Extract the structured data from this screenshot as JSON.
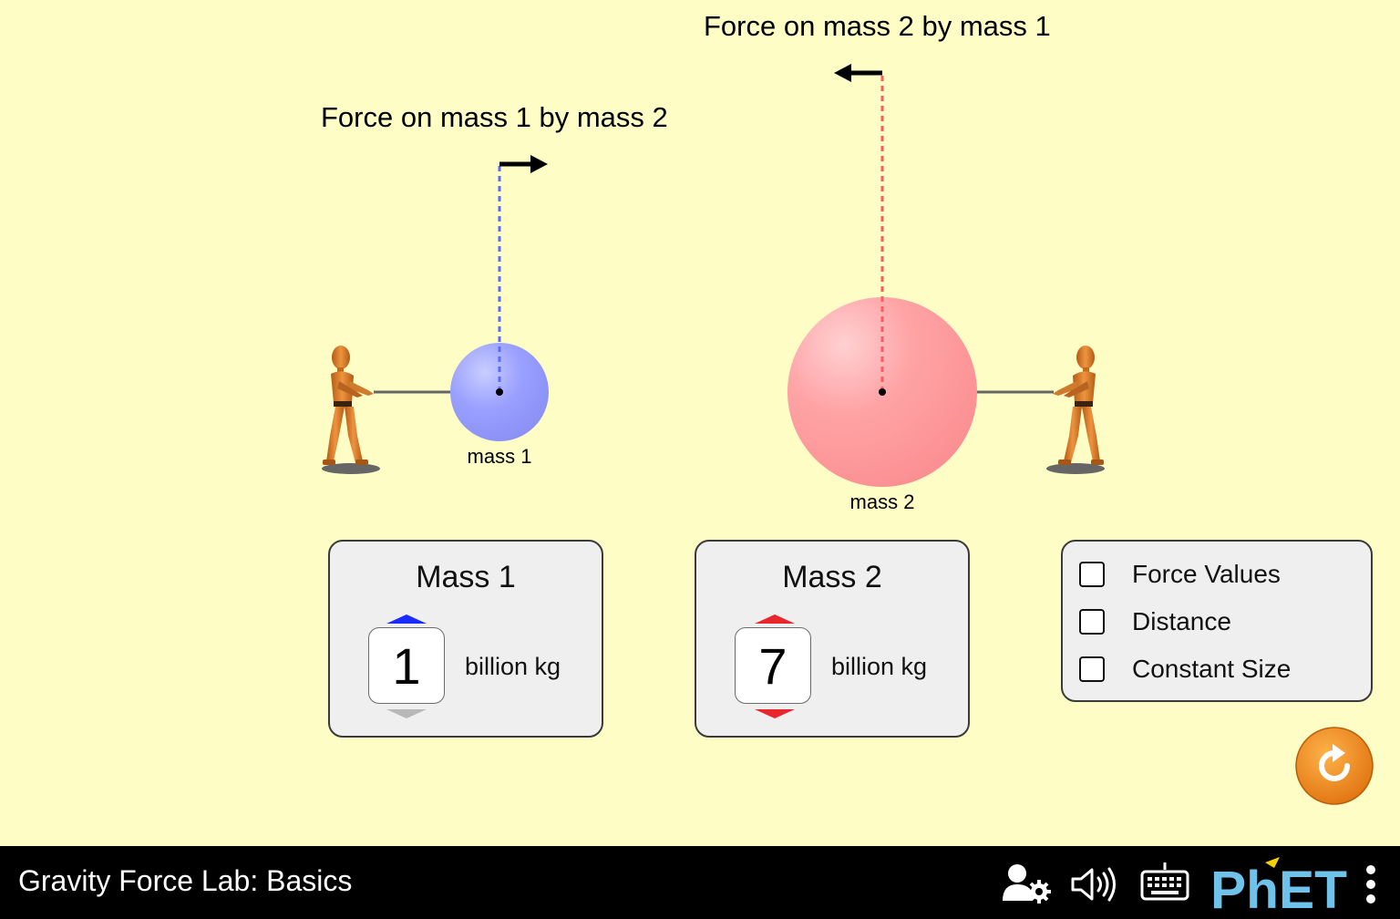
{
  "app": {
    "title": "Gravity Force Lab: Basics",
    "brand": "PhET"
  },
  "forces": {
    "on_mass1": "Force on mass 1 by mass 2",
    "on_mass2": "Force on mass 2 by mass 1"
  },
  "masses": {
    "mass1": {
      "label": "mass 1",
      "color": "#9aa0ff"
    },
    "mass2": {
      "label": "mass 2",
      "color": "#ff9ea0"
    }
  },
  "panels": {
    "mass1": {
      "title": "Mass 1",
      "value": "1",
      "unit": "billion kg",
      "arrow_color": "#1a2cff"
    },
    "mass2": {
      "title": "Mass 2",
      "value": "7",
      "unit": "billion kg",
      "arrow_color": "#e8262b"
    }
  },
  "options": {
    "items": [
      {
        "label": "Force Values",
        "checked": false
      },
      {
        "label": "Distance",
        "checked": false
      },
      {
        "label": "Constant Size",
        "checked": false
      }
    ]
  },
  "nav_icons": [
    "preferences-icon",
    "audio-icon",
    "keyboard-icon",
    "phet-logo",
    "menu-icon"
  ],
  "colors": {
    "background": "#fefdc6",
    "navbar": "#000000",
    "reset": "#f28c1f"
  }
}
